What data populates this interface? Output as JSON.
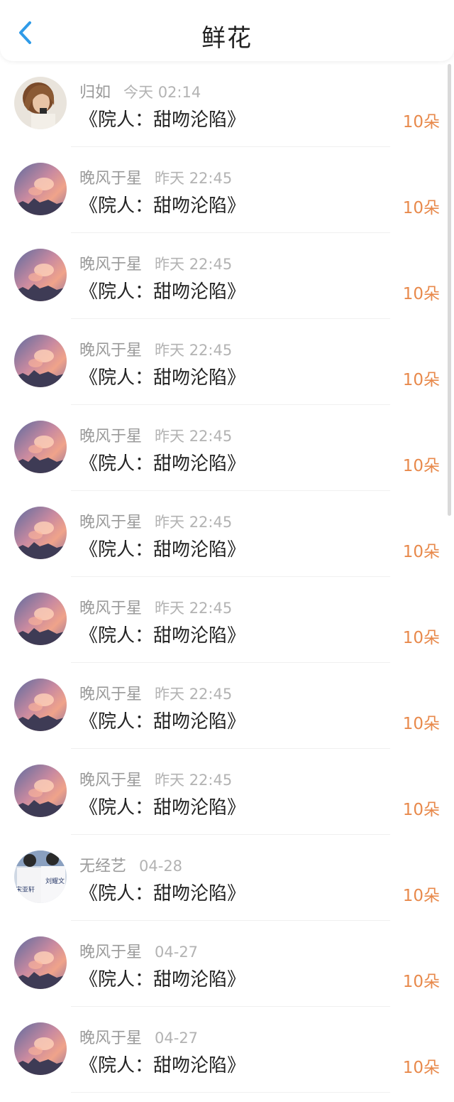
{
  "header": {
    "title": "鲜花",
    "back_icon": "chevron-left-icon",
    "accent_color": "#2f9be8"
  },
  "count_color": "#e8894b",
  "items": [
    {
      "name": "归如",
      "time": "今天 02:14",
      "book": "《院人：甜吻沦陷》",
      "count": "10朵",
      "avatar": "woman-portrait"
    },
    {
      "name": "晚风于星",
      "time": "昨天 22:45",
      "book": "《院人：甜吻沦陷》",
      "count": "10朵",
      "avatar": "sunset-sky"
    },
    {
      "name": "晚风于星",
      "time": "昨天 22:45",
      "book": "《院人：甜吻沦陷》",
      "count": "10朵",
      "avatar": "sunset-sky"
    },
    {
      "name": "晚风于星",
      "time": "昨天 22:45",
      "book": "《院人：甜吻沦陷》",
      "count": "10朵",
      "avatar": "sunset-sky"
    },
    {
      "name": "晚风于星",
      "time": "昨天 22:45",
      "book": "《院人：甜吻沦陷》",
      "count": "10朵",
      "avatar": "sunset-sky"
    },
    {
      "name": "晚风于星",
      "time": "昨天 22:45",
      "book": "《院人：甜吻沦陷》",
      "count": "10朵",
      "avatar": "sunset-sky"
    },
    {
      "name": "晚风于星",
      "time": "昨天 22:45",
      "book": "《院人：甜吻沦陷》",
      "count": "10朵",
      "avatar": "sunset-sky"
    },
    {
      "name": "晚风于星",
      "time": "昨天 22:45",
      "book": "《院人：甜吻沦陷》",
      "count": "10朵",
      "avatar": "sunset-sky"
    },
    {
      "name": "晚风于星",
      "time": "昨天 22:45",
      "book": "《院人：甜吻沦陷》",
      "count": "10朵",
      "avatar": "sunset-sky"
    },
    {
      "name": "无经艺",
      "time": "04-28",
      "book": "《院人：甜吻沦陷》",
      "count": "10朵",
      "avatar": "jersey-photo",
      "avatar_text": [
        "刘耀文",
        "宋亚轩"
      ]
    },
    {
      "name": "晚风于星",
      "time": "04-27",
      "book": "《院人：甜吻沦陷》",
      "count": "10朵",
      "avatar": "sunset-sky"
    },
    {
      "name": "晚风于星",
      "time": "04-27",
      "book": "《院人：甜吻沦陷》",
      "count": "10朵",
      "avatar": "sunset-sky"
    }
  ]
}
